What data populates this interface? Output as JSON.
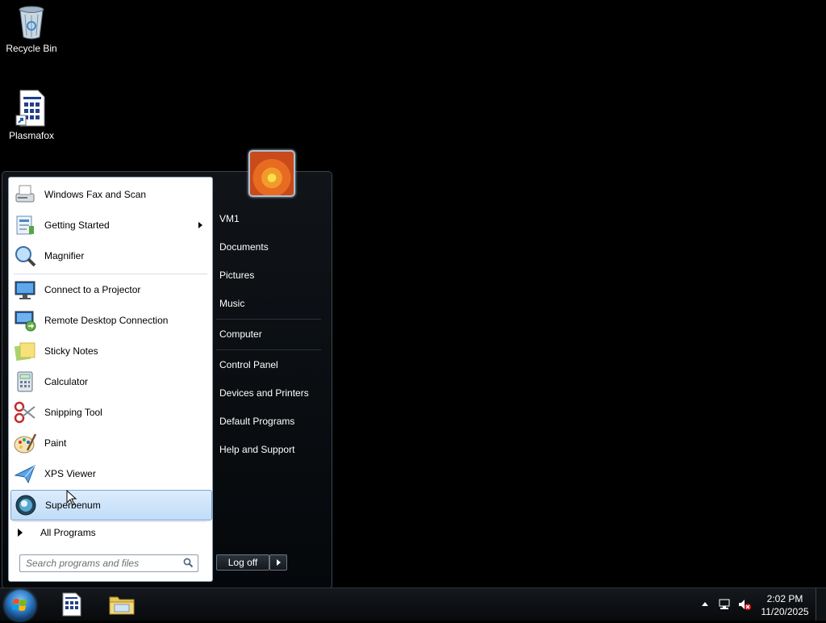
{
  "desktop": {
    "icons": [
      {
        "label": "Recycle Bin",
        "icon": "recycle-bin-icon"
      },
      {
        "label": "Plasmafox",
        "icon": "plasmafox-shortcut-icon"
      }
    ]
  },
  "start_menu": {
    "programs": [
      {
        "label": "Windows Fax and Scan",
        "icon": "fax-scanner-icon"
      },
      {
        "label": "Getting Started",
        "icon": "getting-started-icon",
        "submenu": true
      },
      {
        "label": "Magnifier",
        "icon": "magnifier-icon"
      },
      {
        "label": "Connect to a Projector",
        "icon": "projector-icon"
      },
      {
        "label": "Remote Desktop Connection",
        "icon": "remote-desktop-icon"
      },
      {
        "label": "Sticky Notes",
        "icon": "sticky-notes-icon"
      },
      {
        "label": "Calculator",
        "icon": "calculator-icon"
      },
      {
        "label": "Snipping Tool",
        "icon": "scissors-icon"
      },
      {
        "label": "Paint",
        "icon": "paint-palette-icon"
      },
      {
        "label": "XPS Viewer",
        "icon": "xps-viewer-icon"
      },
      {
        "label": "Superbenum",
        "icon": "superbenum-icon",
        "selected": true
      }
    ],
    "all_programs": "All Programs",
    "search": {
      "placeholder": "Search programs and files",
      "value": ""
    },
    "right_links": {
      "user": "VM1",
      "documents": "Documents",
      "pictures": "Pictures",
      "music": "Music",
      "computer": "Computer",
      "control_panel": "Control Panel",
      "devices": "Devices and Printers",
      "default_programs": "Default Programs",
      "help": "Help and Support"
    },
    "logoff": "Log off"
  },
  "taskbar": {
    "time": "2:02 PM",
    "date": "11/20/2025",
    "pinned": [
      "plasmafox-taskbar-icon",
      "file-explorer-icon"
    ]
  },
  "colors": {
    "selected_bg": "#c9e0f8",
    "menu_border": "#3c4650",
    "desktop_bg": "#000000"
  }
}
